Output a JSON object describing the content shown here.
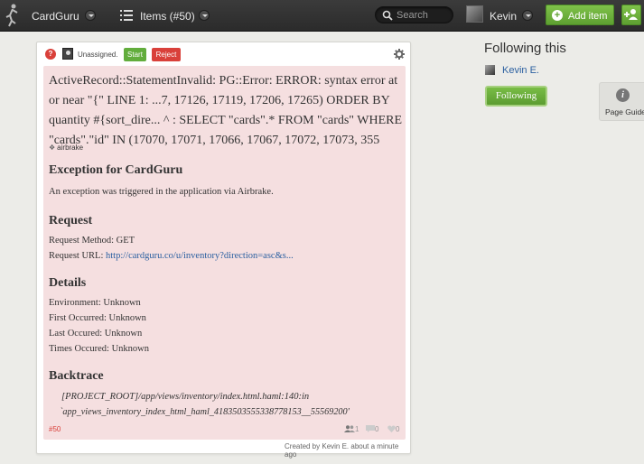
{
  "topbar": {
    "app_name": "CardGuru",
    "items_label": "Items (#50)",
    "search_placeholder": "Search",
    "user_name": "Kevin",
    "add_item_label": "Add item"
  },
  "card": {
    "assignee": "Unassigned.",
    "start_label": "Start",
    "reject_label": "Reject",
    "title": "ActiveRecord::StatementInvalid: PG::Error: ERROR: syntax error at or near \"{\" LINE 1: ...7, 17126, 17119, 17206, 17265) ORDER BY quantity #{sort_dire... ^ : SELECT \"cards\".* FROM \"cards\" WHERE \"cards\".\"id\" IN (17070, 17071, 17066, 17067, 17072, 17073, 355",
    "tag": "airbrake",
    "exception_heading": "Exception for CardGuru",
    "exception_text": "An exception was triggered in the application via Airbrake.",
    "request_heading": "Request",
    "request_method": "Request Method: GET",
    "request_url_label": "Request URL: ",
    "request_url": "http://cardguru.co/u/inventory?direction=asc&s...",
    "details_heading": "Details",
    "environment": "Environment: Unknown",
    "first_occurred": "First Occurred: Unknown",
    "last_occured": "Last Occured: Unknown",
    "times_occured": "Times Occured: Unknown",
    "backtrace_heading": "Backtrace",
    "backtrace_line1": "[PROJECT_ROOT]/app/views/inventory/index.html.haml:140:in",
    "backtrace_line2": "`app_views_inventory_index_html_haml_4183503555338778153__55569200'",
    "number": "#50",
    "watchers_count": "1",
    "comments_count": "0",
    "likes_count": "0",
    "created_by": "Created by Kevin E. about a minute ago"
  },
  "sidebar": {
    "following_title": "Following this",
    "follower_name": "Kevin E.",
    "following_button": "Following"
  },
  "page_guide": {
    "label": "Page Guide"
  },
  "colors": {
    "accent_green": "#5ea031",
    "danger_red": "#d9403a",
    "card_pink": "#f5dfe0",
    "link_blue": "#2a5fa0"
  }
}
